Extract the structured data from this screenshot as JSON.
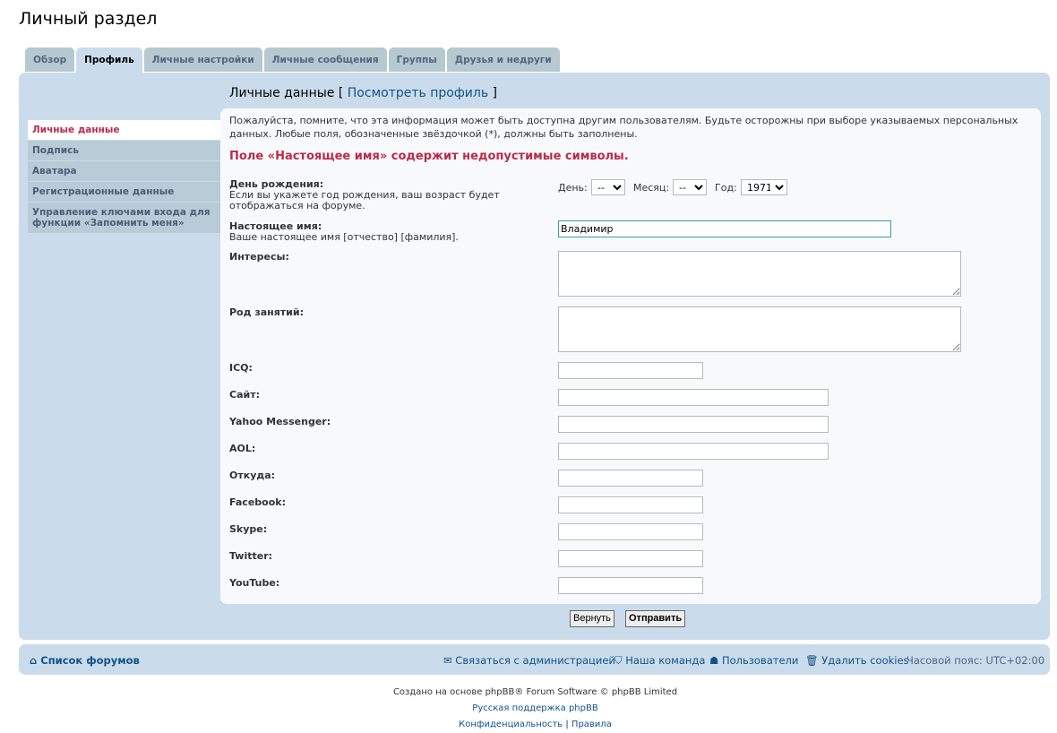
{
  "page_title": "Личный раздел",
  "tabs": [
    "Обзор",
    "Профиль",
    "Личные настройки",
    "Личные сообщения",
    "Группы",
    "Друзья и недруги"
  ],
  "heading": {
    "title": "Личные данные",
    "open": "[",
    "link": "Посмотреть профиль",
    "close": "]"
  },
  "sidebar": [
    "Личные данные",
    "Подпись",
    "Аватара",
    "Регистрационные данные",
    "Управление ключами входа для функции «Запомнить меня»"
  ],
  "notice": "Пожалуйста, помните, что эта информация может быть доступна другим пользователям. Будьте осторожны при выборе указываемых персональных данных. Любые поля, обозначенные звёздочкой (*), должны быть заполнены.",
  "error": "Поле «Настоящее имя» содержит недопустимые символы.",
  "birthday": {
    "label": "День рождения:",
    "desc": "Если вы укажете год рождения, ваш возраст будет отображаться на форуме.",
    "day_label": "День:",
    "day": "--",
    "month_label": "Месяц:",
    "month": "--",
    "year_label": "Год:",
    "year": "1971"
  },
  "realname": {
    "label": "Настоящее имя:",
    "desc": "Ваше настоящее имя [отчество] [фамилия].",
    "value": "Владимир"
  },
  "fields": {
    "interests": "Интересы:",
    "occupation": "Род занятий:",
    "icq": "ICQ:",
    "site": "Сайт:",
    "yahoo": "Yahoo Messenger:",
    "aol": "AOL:",
    "location": "Откуда:",
    "facebook": "Facebook:",
    "skype": "Skype:",
    "twitter": "Twitter:",
    "youtube": "YouTube:"
  },
  "buttons": {
    "reset": "Вернуть",
    "submit": "Отправить"
  },
  "footer": {
    "index": "Список форумов",
    "contact": "Связаться с администрацией",
    "team": "Наша команда",
    "members": "Пользователи",
    "cookies": "Удалить cookies",
    "timezone": "Часовой пояс: UTC+02:00"
  },
  "credits": {
    "line1": "Создано на основе phpBB® Forum Software © phpBB Limited",
    "line2": "Русская поддержка phpBB",
    "privacy": "Конфиденциальность",
    "sep": "|",
    "rules": "Правила"
  }
}
